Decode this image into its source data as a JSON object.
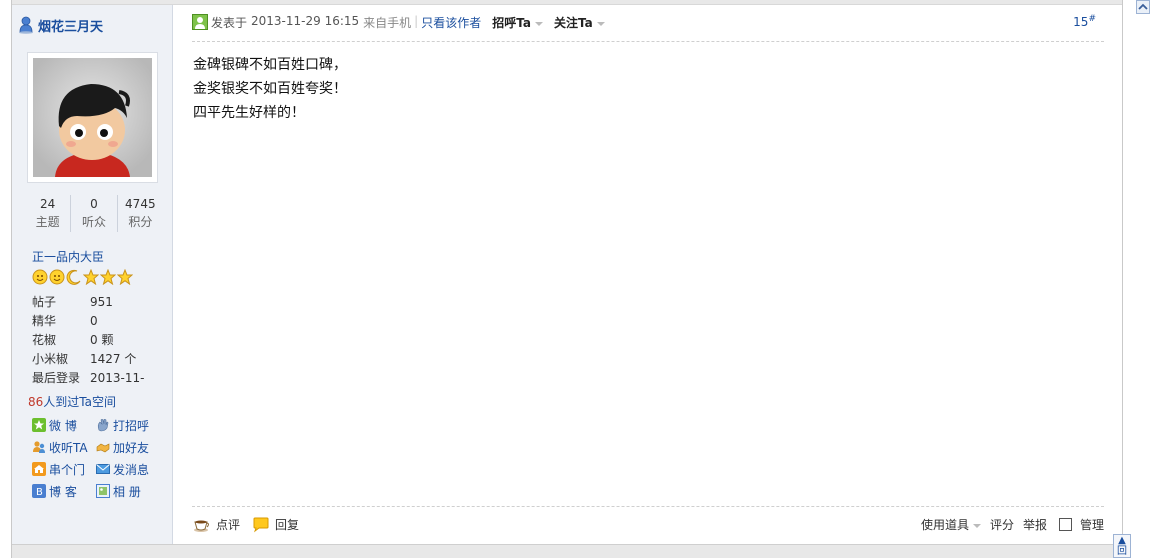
{
  "author": {
    "name": "烟花三月天"
  },
  "stats": [
    {
      "num": "24",
      "label": "主题"
    },
    {
      "num": "0",
      "label": "听众"
    },
    {
      "num": "4745",
      "label": "积分"
    }
  ],
  "rank": "正一品内大臣",
  "info": [
    {
      "key": "帖子",
      "value": "951"
    },
    {
      "key": "精华",
      "value": "0"
    },
    {
      "key": "花椒",
      "value": "0 颗"
    },
    {
      "key": "小米椒",
      "value": "1427 个"
    },
    {
      "key": "最后登录",
      "value": "2013-11-"
    }
  ],
  "visitors": {
    "count": "86",
    "text": "人到过Ta空间"
  },
  "actions": [
    {
      "label": "微 博",
      "icon": "weibo-icon"
    },
    {
      "label": "打招呼",
      "icon": "wave-hand-icon"
    },
    {
      "label": "收听TA",
      "icon": "users-icon"
    },
    {
      "label": "加好友",
      "icon": "handshake-icon"
    },
    {
      "label": "串个门",
      "icon": "home-icon"
    },
    {
      "label": "发消息",
      "icon": "envelope-icon"
    },
    {
      "label": "博 客",
      "icon": "blog-icon"
    },
    {
      "label": "相 册",
      "icon": "photo-album-icon"
    }
  ],
  "post": {
    "posted_label": "发表于",
    "time": "2013-11-29 16:15",
    "from": "来自手机",
    "sep": "|",
    "only_author": "只看该作者",
    "greet": "招呼Ta",
    "follow": "关注Ta",
    "floor": "15",
    "floor_mark": "#",
    "lines": [
      "金碑银碑不如百姓口碑，",
      "金奖银奖不如百姓夸奖！",
      "四平先生好样的！"
    ]
  },
  "footer": {
    "comment": "点评",
    "reply": "回复",
    "tools": "使用道具",
    "rate": "评分",
    "report": "举报",
    "manage": "管理"
  },
  "backtop": "回",
  "colors": {
    "link": "#1a4e9e",
    "sidebar_bg": "#eef1f6",
    "visitor_count": "#c0392b"
  }
}
